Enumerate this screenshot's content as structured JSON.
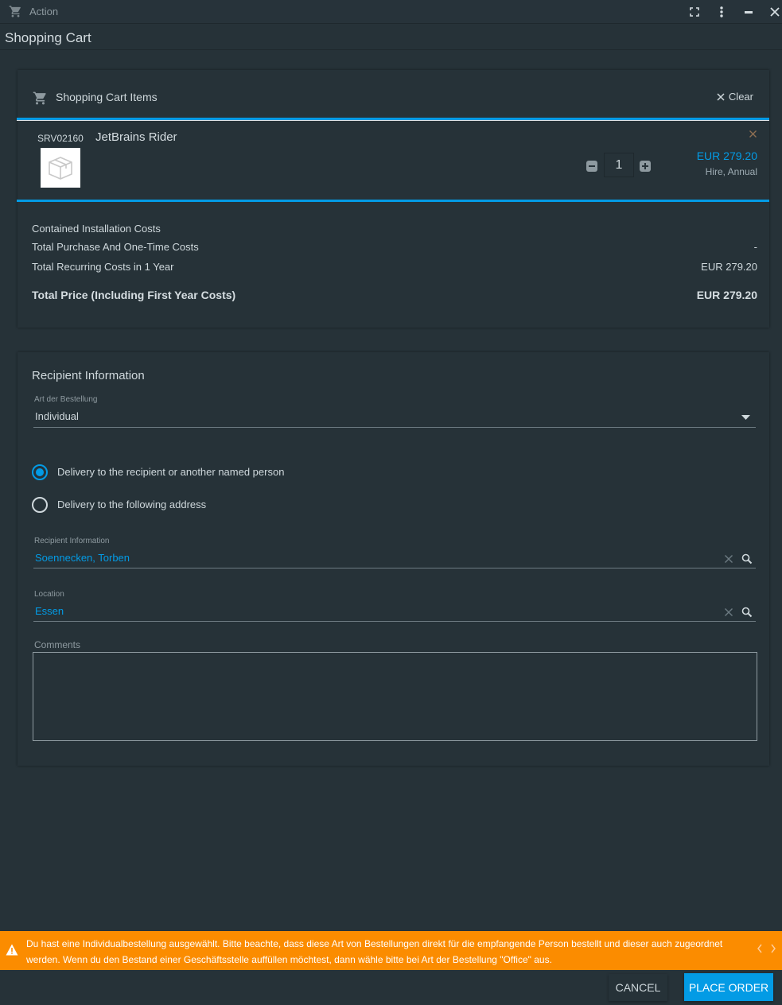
{
  "window": {
    "title": "Action",
    "icons": [
      "cart-icon",
      "fullscreen-icon",
      "more-vert-icon",
      "minimize-icon",
      "close-icon"
    ]
  },
  "page_title": "Shopping Cart",
  "cart": {
    "header": "Shopping Cart Items",
    "clear_label": "Clear",
    "items": [
      {
        "sku": "SRV02160",
        "name": "JetBrains Rider",
        "quantity": "1",
        "price": "EUR 279.20",
        "period": "Hire, Annual",
        "image_icon": "package-icon"
      }
    ],
    "summary": {
      "installation_label": "Contained Installation Costs",
      "installation_value": "",
      "one_time_label": "Total Purchase And One-Time Costs",
      "one_time_value": "-",
      "recurring_label": "Total Recurring Costs in 1 Year",
      "recurring_value": "EUR 279.20",
      "total_label": "Total Price (Including First Year Costs)",
      "total_value": "EUR 279.20"
    }
  },
  "recipient": {
    "title": "Recipient Information",
    "order_type": {
      "label": "Art der Bestellung",
      "value": "Individual"
    },
    "delivery_options": [
      {
        "label": "Delivery to the recipient or another named person",
        "selected": true
      },
      {
        "label": "Delivery to the following address",
        "selected": false
      }
    ],
    "recipient_field": {
      "label": "Recipient Information",
      "value": "Soennecken, Torben"
    },
    "location_field": {
      "label": "Location",
      "value": "Essen"
    },
    "comments": {
      "label": "Comments",
      "value": ""
    }
  },
  "warning": {
    "text": "Du hast eine Individualbestellung ausgewählt. Bitte beachte, dass diese Art von Bestellungen direkt für die empfangende Person bestellt und dieser auch zugeordnet werden. Wenn du den Bestand einer Geschäftsstelle auffüllen möchtest, dann wähle bitte bei Art der Bestellung \"Office\" aus."
  },
  "actions": {
    "cancel": "CANCEL",
    "place_order": "PLACE ORDER"
  },
  "colors": {
    "background": "#263238",
    "accent": "#039be5",
    "warning": "#fb8c00",
    "text": "#cfd8dc"
  }
}
